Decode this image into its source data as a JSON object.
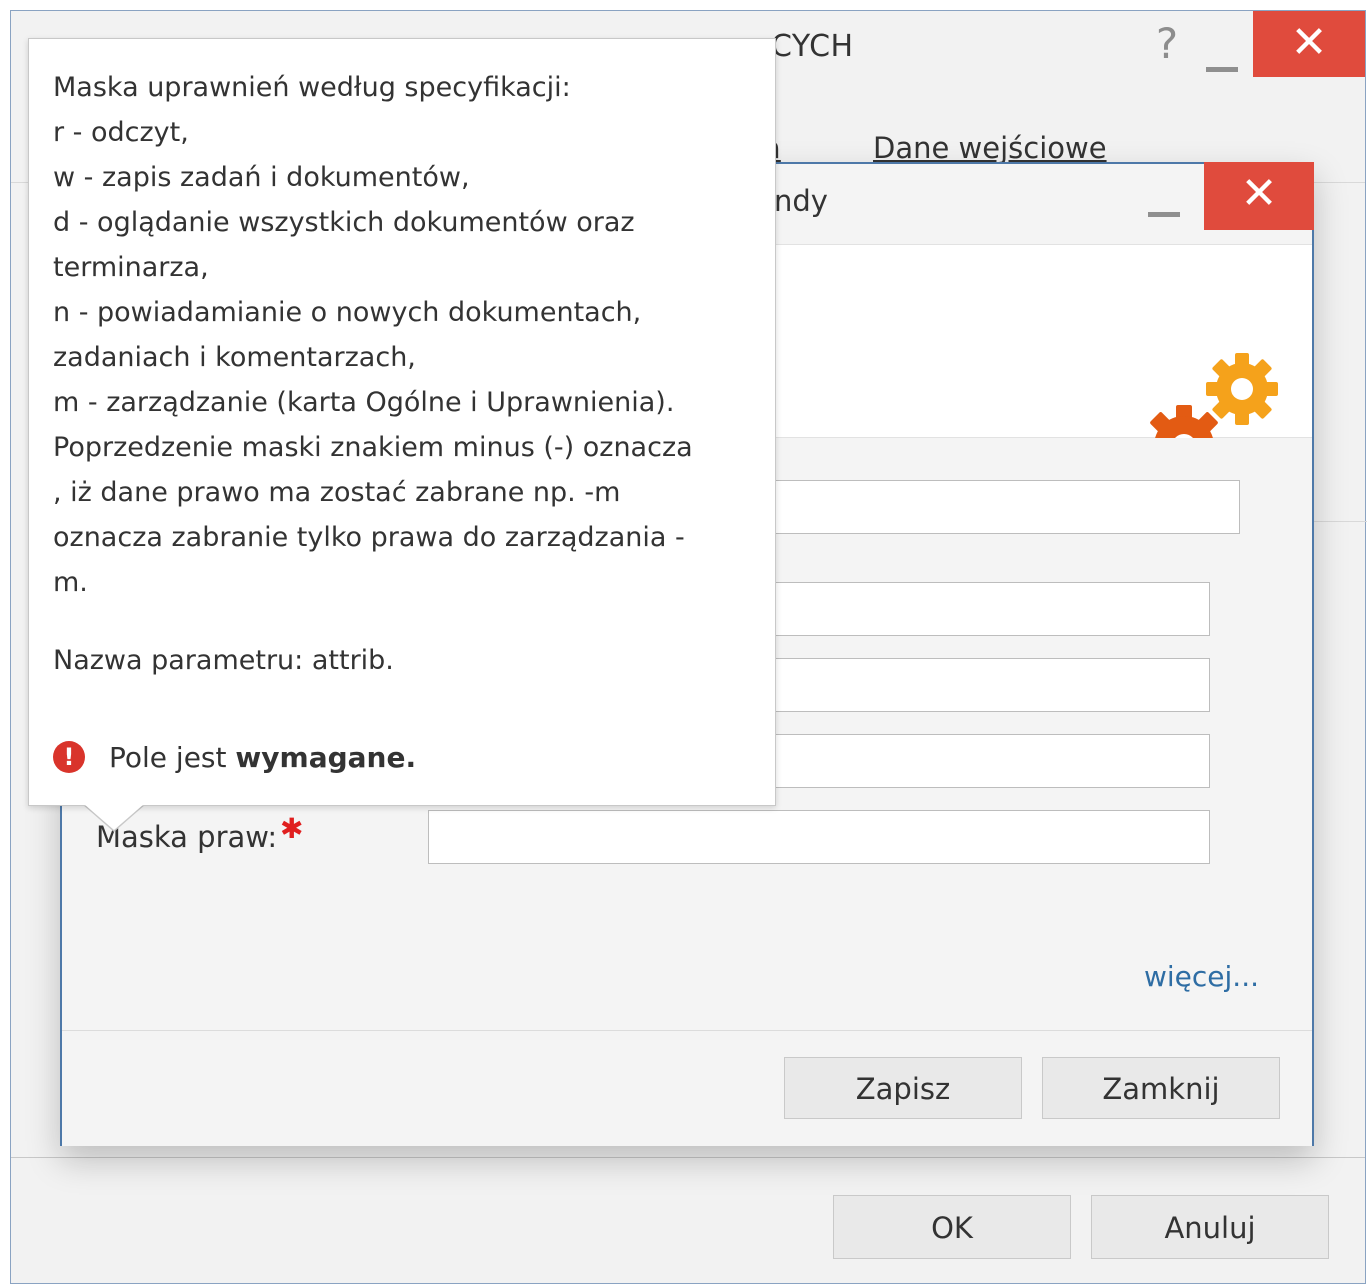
{
  "outer_window": {
    "title_visible": "CYCH",
    "help_glyph": "?",
    "minimize_glyph": "minimize-icon",
    "close_glyph": "✕",
    "tabs": [
      {
        "label": "ia"
      },
      {
        "label": "Dane wejściowe"
      }
    ],
    "ok_label": "OK",
    "cancel_label": "Anuluj"
  },
  "inner_window": {
    "title_visible": "ndy",
    "close_glyph": "✕",
    "header_icon": "gears-icon",
    "accent_colors": {
      "gear_light": "#f5a21b",
      "gear_dark": "#e35b13",
      "close": "#e04b3d",
      "border": "#4d78a8",
      "link": "#2e6da4"
    },
    "mask_label": "Maska praw:",
    "required_marker": "✱",
    "more_link": "więcej...",
    "save_label": "Zapisz",
    "close_label": "Zamknij"
  },
  "tooltip": {
    "lines": [
      "Maska uprawnień według specyfikacji:",
      "r - odczyt,",
      "w - zapis zadań i dokumentów,",
      "d - oglądanie wszystkich dokumentów oraz",
      "terminarza,",
      "n - powiadamianie o nowych dokumentach,",
      "zadaniach i komentarzach,",
      "m - zarządzanie (karta Ogólne i Uprawnienia).",
      "Poprzedzenie maski znakiem minus (-) oznacza",
      ", iż dane prawo ma zostać zabrane np. -m",
      "oznacza zabranie tylko prawa do zarządzania -",
      "m."
    ],
    "param_name": "Nazwa parametru: attrib.",
    "required_prefix": "Pole jest ",
    "required_bold": "wymagane.",
    "error_icon": "exclamation-icon",
    "error_glyph": "!"
  }
}
